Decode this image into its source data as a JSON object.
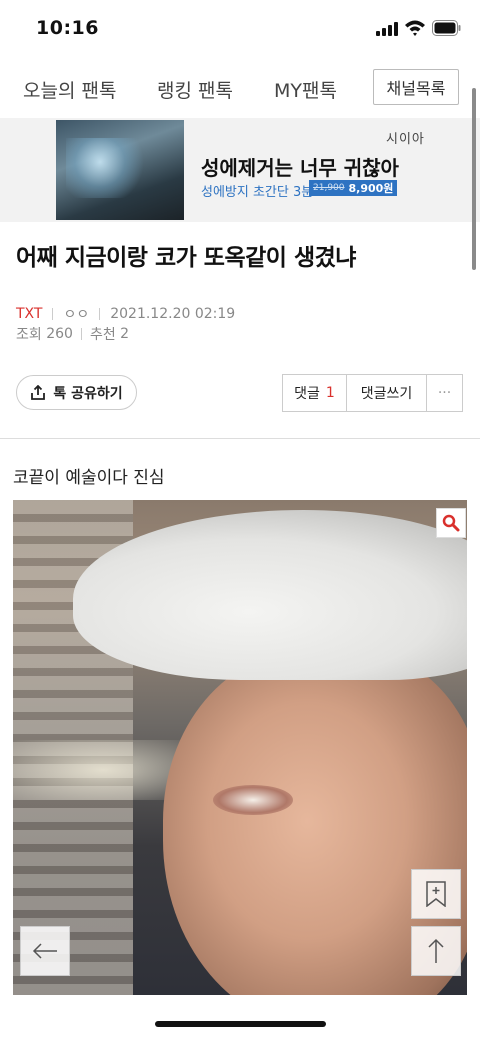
{
  "status_bar": {
    "time": "10:16"
  },
  "nav": {
    "tabs": [
      {
        "label": "오늘의 팬톡"
      },
      {
        "label": "랭킹 팬톡"
      },
      {
        "label": "MY팬톡"
      }
    ],
    "channel_button": "채널목록"
  },
  "ad": {
    "brand": "시이아",
    "headline": "성에제거는 너무 귀찮아",
    "sub": "성에방지 초간단 3분",
    "old_price": "21,900",
    "new_price": "8,900원"
  },
  "article": {
    "title": "어째 지금이랑 코가 또옥같이 생겼냐",
    "author": "TXT",
    "nickname": "ㅇㅇ",
    "datetime": "2021.12.20 02:19",
    "views_label": "조회",
    "views": "260",
    "recommend_label": "추천",
    "recommend": "2",
    "body": "코끝이 예술이다 진심"
  },
  "actions": {
    "share_label": "톡 공유하기",
    "comments_label": "댓글",
    "comments_count": "1",
    "write_comment_label": "댓글쓰기",
    "more_label": "···"
  },
  "colors": {
    "accent_red": "#d9302c",
    "ad_blue": "#2e73c2"
  }
}
